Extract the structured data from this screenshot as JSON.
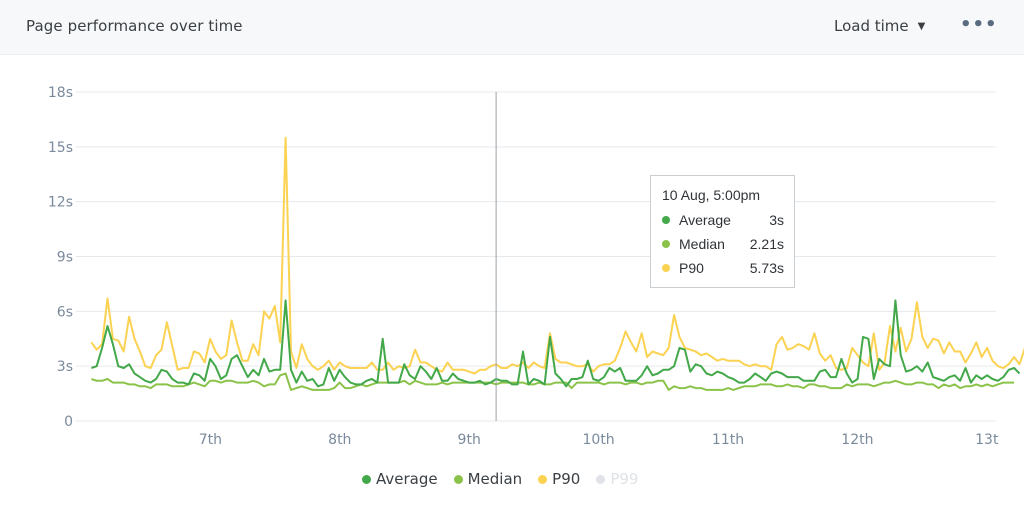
{
  "header": {
    "title": "Page performance over time",
    "metric_select": "Load time",
    "more_icon": "ellipsis-icon"
  },
  "tooltip": {
    "title": "10 Aug, 5:00pm",
    "rows": [
      {
        "label": "Average",
        "value": "3s",
        "color": "#43a849"
      },
      {
        "label": "Median",
        "value": "2.21s",
        "color": "#8bc34a"
      },
      {
        "label": "P90",
        "value": "5.73s",
        "color": "#fbd251"
      }
    ]
  },
  "legend": [
    {
      "label": "Average",
      "color": "#43a849",
      "enabled": true
    },
    {
      "label": "Median",
      "color": "#8bc34a",
      "enabled": true
    },
    {
      "label": "P90",
      "color": "#fbd251",
      "enabled": true
    },
    {
      "label": "P99",
      "color": "#dfe3e7",
      "enabled": false
    }
  ],
  "chart_data": {
    "type": "line",
    "title": "Page performance over time",
    "xlabel": "",
    "ylabel": "Load time",
    "y_ticks": [
      "0",
      "3s",
      "6s",
      "9s",
      "12s",
      "15s",
      "18s"
    ],
    "y_tick_values": [
      0,
      3,
      6,
      9,
      12,
      15,
      18
    ],
    "ylim": [
      0,
      18
    ],
    "x_ticks": [
      "7th",
      "8th",
      "9th",
      "10th",
      "11th",
      "12th",
      "13t"
    ],
    "x_tick_values_days": [
      1,
      2,
      3,
      4,
      5,
      6,
      7
    ],
    "xlim_days": [
      0,
      7
    ],
    "x_start_day": 0.08,
    "x_step_days": 0.0417,
    "grid": true,
    "legend_position": "bottom",
    "crosshair_day": 3.208,
    "series": [
      {
        "name": "Average",
        "color": "#43a849",
        "values": [
          2.9,
          3.0,
          4.0,
          5.2,
          4.2,
          3.0,
          2.9,
          3.1,
          2.6,
          2.4,
          2.2,
          2.1,
          2.3,
          2.8,
          2.7,
          2.3,
          2.1,
          2.1,
          2.0,
          2.6,
          2.5,
          2.2,
          3.4,
          3.0,
          2.3,
          2.5,
          3.4,
          3.6,
          3.0,
          2.4,
          2.8,
          2.5,
          3.4,
          2.7,
          2.8,
          2.8,
          6.6,
          2.8,
          2.1,
          2.7,
          2.2,
          2.3,
          1.9,
          2.0,
          2.9,
          2.2,
          2.8,
          2.4,
          2.1,
          2.0,
          2.0,
          2.2,
          2.3,
          2.1,
          4.5,
          2.1,
          2.1,
          2.1,
          3.1,
          2.5,
          2.3,
          3.0,
          2.7,
          2.3,
          2.9,
          2.2,
          2.2,
          2.6,
          2.3,
          2.2,
          2.1,
          2.1,
          2.2,
          2.0,
          2.1,
          2.3,
          2.2,
          2.2,
          2.0,
          2.0,
          3.8,
          2.0,
          2.3,
          2.2,
          2.0,
          4.6,
          2.6,
          2.3,
          1.9,
          2.3,
          2.3,
          2.4,
          3.3,
          2.3,
          2.2,
          2.4,
          2.9,
          2.7,
          2.9,
          2.2,
          2.2,
          2.2,
          2.5,
          3.0,
          2.5,
          2.6,
          2.8,
          2.8,
          3.0,
          4.0,
          3.9,
          2.7,
          3.1,
          3.0,
          2.6,
          2.5,
          2.7,
          2.6,
          2.4,
          2.3,
          2.1,
          2.1,
          2.3,
          2.6,
          2.4,
          2.2,
          2.6,
          2.7,
          2.6,
          2.4,
          2.4,
          2.4,
          2.2,
          2.2,
          2.2,
          2.7,
          2.8,
          2.4,
          2.4,
          3.4,
          2.6,
          2.1,
          2.3,
          4.6,
          4.5,
          2.3,
          3.4,
          3.1,
          3.0,
          6.6,
          3.6,
          2.7,
          2.8,
          3.0,
          2.7,
          3.2,
          2.4,
          2.3,
          2.2,
          2.4,
          2.5,
          2.2,
          2.9,
          2.1,
          2.5,
          2.3,
          2.5,
          2.3,
          2.2,
          2.4,
          2.8,
          2.9,
          2.6
        ]
      },
      {
        "name": "Median",
        "color": "#8bc34a",
        "values": [
          2.3,
          2.2,
          2.2,
          2.3,
          2.1,
          2.1,
          2.1,
          2.0,
          2.0,
          1.9,
          1.9,
          1.8,
          2.0,
          2.0,
          2.0,
          1.9,
          1.9,
          1.9,
          2.0,
          2.1,
          2.0,
          1.9,
          2.2,
          2.2,
          2.1,
          2.2,
          2.2,
          2.1,
          2.1,
          2.1,
          2.2,
          2.1,
          1.9,
          2.0,
          2.0,
          2.5,
          2.6,
          1.7,
          1.8,
          1.9,
          1.8,
          1.7,
          1.7,
          1.7,
          1.7,
          1.8,
          2.1,
          1.8,
          1.8,
          1.9,
          2.0,
          1.9,
          2.0,
          2.1,
          2.1,
          2.1,
          2.1,
          2.1,
          2.2,
          2.0,
          2.2,
          2.1,
          2.0,
          2.0,
          2.0,
          2.1,
          2.0,
          2.1,
          2.1,
          2.1,
          2.1,
          2.1,
          2.1,
          2.1,
          2.1,
          2.0,
          2.1,
          2.1,
          2.1,
          2.1,
          2.1,
          2.0,
          2.0,
          2.1,
          2.0,
          2.0,
          2.1,
          2.1,
          2.1,
          1.8,
          2.1,
          2.1,
          2.1,
          2.1,
          2.1,
          2.0,
          2.1,
          2.1,
          2.1,
          2.0,
          2.1,
          2.1,
          2.0,
          2.1,
          2.1,
          2.2,
          2.2,
          1.7,
          1.9,
          1.8,
          1.8,
          1.9,
          1.8,
          1.8,
          1.7,
          1.7,
          1.7,
          1.7,
          1.8,
          1.7,
          1.8,
          1.9,
          1.9,
          1.9,
          2.0,
          2.0,
          2.0,
          1.9,
          1.9,
          2.0,
          1.9,
          1.9,
          1.8,
          2.0,
          2.0,
          1.9,
          1.9,
          1.8,
          1.8,
          1.8,
          2.0,
          1.9,
          2.0,
          2.0,
          2.0,
          1.9,
          2.0,
          2.1,
          2.1,
          2.2,
          2.1,
          2.0,
          2.0,
          2.1,
          2.1,
          2.0,
          2.0,
          1.8,
          2.0,
          1.9,
          2.0,
          1.8,
          1.9,
          1.9,
          2.0,
          1.9,
          2.0,
          1.9,
          2.0,
          2.1,
          2.1,
          2.1
        ]
      },
      {
        "name": "P90",
        "color": "#fbd251",
        "values": [
          4.3,
          3.9,
          4.2,
          6.7,
          4.5,
          4.4,
          3.8,
          5.7,
          4.5,
          3.8,
          3.0,
          2.9,
          3.6,
          3.9,
          5.4,
          4.1,
          2.8,
          2.9,
          2.9,
          3.8,
          3.7,
          3.2,
          4.5,
          3.8,
          3.4,
          3.6,
          5.5,
          4.3,
          3.3,
          3.3,
          4.2,
          3.6,
          6.0,
          5.6,
          6.3,
          4.3,
          15.5,
          3.8,
          2.9,
          4.2,
          3.4,
          3.0,
          2.8,
          3.0,
          3.3,
          2.8,
          3.2,
          3.0,
          2.9,
          2.9,
          2.9,
          2.9,
          3.2,
          2.8,
          2.8,
          3.2,
          2.8,
          3.0,
          2.9,
          3.0,
          3.9,
          3.2,
          3.2,
          3.0,
          2.8,
          2.7,
          3.2,
          2.8,
          2.8,
          2.8,
          2.7,
          2.6,
          2.8,
          2.8,
          3.0,
          3.1,
          2.9,
          2.9,
          3.1,
          3.0,
          3.2,
          2.9,
          3.2,
          3.0,
          2.9,
          4.8,
          3.4,
          3.2,
          3.2,
          3.1,
          3.0,
          3.0,
          3.1,
          2.7,
          3.0,
          3.1,
          3.1,
          3.3,
          4.0,
          4.9,
          4.3,
          3.8,
          4.8,
          3.5,
          3.8,
          3.7,
          3.6,
          4.0,
          5.8,
          4.6,
          4.0,
          3.9,
          3.8,
          3.6,
          3.7,
          3.5,
          3.3,
          3.4,
          3.3,
          3.3,
          3.3,
          3.1,
          3.0,
          3.1,
          3.0,
          3.0,
          2.8,
          4.2,
          4.6,
          3.9,
          4.0,
          4.2,
          4.1,
          3.9,
          4.8,
          3.7,
          3.3,
          3.6,
          2.9,
          2.8,
          2.9,
          4.0,
          3.6,
          3.2,
          3.0,
          4.8,
          2.8,
          3.2,
          5.2,
          3.8,
          5.1,
          3.8,
          4.5,
          6.5,
          4.6,
          4.0,
          4.5,
          4.4,
          3.7,
          4.3,
          3.8,
          3.8,
          3.2,
          3.7,
          4.3,
          3.5,
          4.0,
          3.3,
          3.0,
          2.9,
          3.1,
          3.5,
          3.1,
          4.0,
          4.6,
          3.6
        ]
      }
    ]
  }
}
